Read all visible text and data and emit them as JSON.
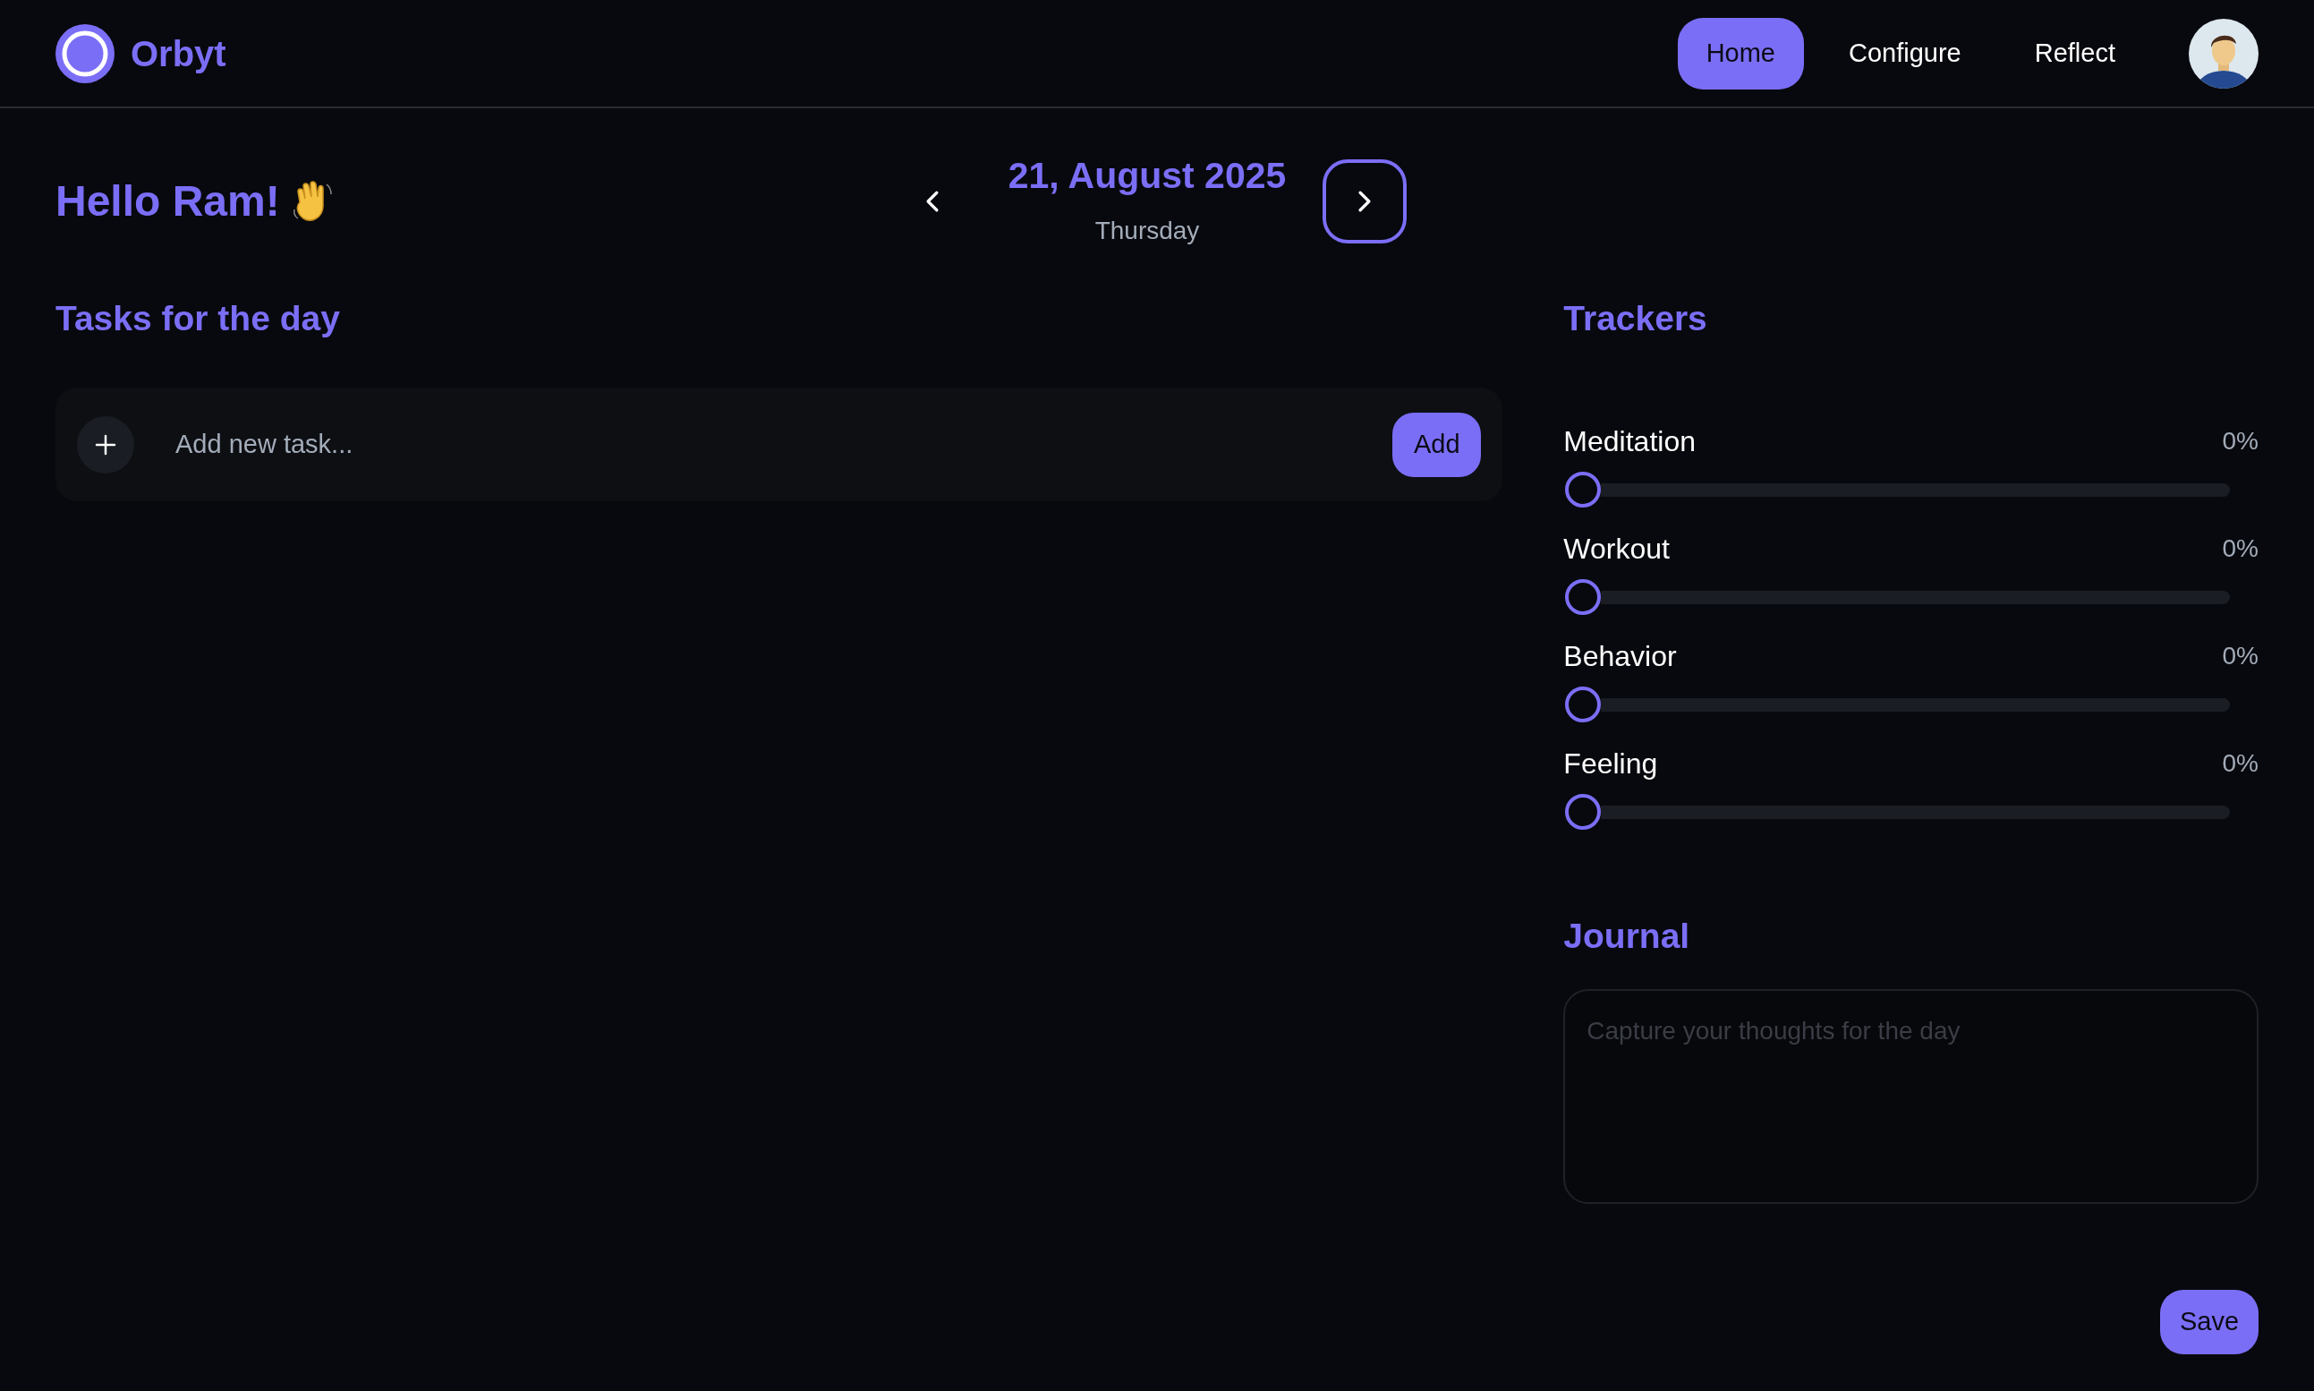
{
  "brand": {
    "name": "Orbyt"
  },
  "nav": [
    {
      "label": "Home",
      "selected": true
    },
    {
      "label": "Configure",
      "selected": false
    },
    {
      "label": "Reflect",
      "selected": false
    }
  ],
  "greeting": "Hello Ram!",
  "date": {
    "title": "21, August 2025",
    "weekday": "Thursday"
  },
  "tasks": {
    "heading": "Tasks for the day",
    "input": {
      "placeholder": "Add new task..."
    },
    "button": "Add"
  },
  "trackers": {
    "heading": "Trackers",
    "items": [
      {
        "name": "Meditation",
        "level": 0,
        "reading": "0%"
      },
      {
        "name": "Workout",
        "level": 0,
        "reading": "0%"
      },
      {
        "name": "Behavior",
        "level": 0,
        "reading": "0%"
      },
      {
        "name": "Feeling",
        "level": 0,
        "reading": "0%"
      }
    ]
  },
  "journal": {
    "heading": "Journal",
    "placeholder": "Capture your thoughts for the day"
  },
  "save_button": "Save"
}
